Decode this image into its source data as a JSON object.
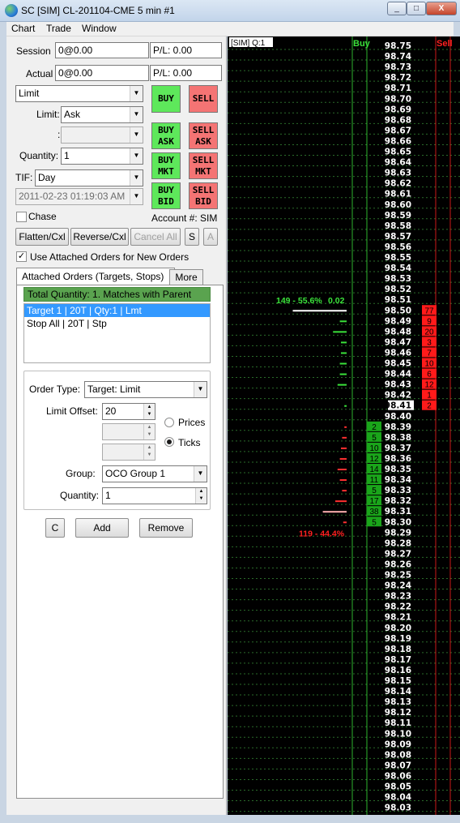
{
  "window": {
    "title": "SC [SIM] CL-201104-CME  5 min  #1",
    "minimize": "_",
    "maximize": "□",
    "close": "X"
  },
  "menu": [
    "Chart",
    "Trade",
    "Window"
  ],
  "session": {
    "label": "Session",
    "value": "0@0.00",
    "pl": "P/L: 0.00"
  },
  "actual": {
    "label": "Actual",
    "value": "0@0.00",
    "pl": "P/L: 0.00"
  },
  "order_type": "Limit",
  "limit": {
    "label": "Limit:",
    "value": "Ask"
  },
  "colon_label": ":",
  "quantity": {
    "label": "Quantity:",
    "value": "1"
  },
  "tif": {
    "label": "TIF:",
    "value": "Day"
  },
  "datetime": "2011-02-23 01:19:03 AM",
  "chase_label": "Chase",
  "account": "Account #: SIM",
  "buttons": {
    "buy": "BUY",
    "sell": "SELL",
    "buy_ask": [
      "BUY",
      "ASK"
    ],
    "sell_ask": [
      "SELL",
      "ASK"
    ],
    "buy_mkt": [
      "BUY",
      "MKT"
    ],
    "sell_mkt": [
      "SELL",
      "MKT"
    ],
    "buy_bid": [
      "BUY",
      "BID"
    ],
    "sell_bid": [
      "SELL",
      "BID"
    ],
    "flatten": "Flatten/Cxl",
    "reverse": "Reverse/Cxl",
    "cancel_all": "Cancel All",
    "s": "S",
    "a": "A",
    "c": "C",
    "add": "Add",
    "remove": "Remove"
  },
  "attached": {
    "use_label": "Use Attached Orders for New Orders",
    "tab_targets": "Attached Orders (Targets, Stops)",
    "tab_more": "More",
    "total_qty": "Total Quantity: 1. Matches with Parent",
    "list": [
      "Target 1 | 20T | Qty:1 | Lmt",
      "Stop All | 20T | Stp"
    ],
    "order_type_label": "Order Type:",
    "order_type": "Target: Limit",
    "limit_offset_label": "Limit Offset:",
    "limit_offset": "20",
    "prices_label": "Prices",
    "ticks_label": "Ticks",
    "group_label": "Group:",
    "group": "OCO Group 1",
    "quantity_label": "Quantity:",
    "quantity": "1"
  },
  "dom": {
    "header": "[SIM]  Q:1",
    "buy_label": "Buy",
    "sell_label": "Sell",
    "buy_summary": "149 - 55.6%",
    "buy_summary2": "0.02",
    "sell_summary": "119 - 44.4%",
    "prices": [
      "98.75",
      "98.74",
      "98.73",
      "98.72",
      "98.71",
      "98.70",
      "98.69",
      "98.68",
      "98.67",
      "98.66",
      "98.65",
      "98.64",
      "98.63",
      "98.62",
      "98.61",
      "98.60",
      "98.59",
      "98.58",
      "98.57",
      "98.56",
      "98.55",
      "98.54",
      "98.53",
      "98.52",
      "98.51",
      "98.50",
      "98.49",
      "98.48",
      "98.47",
      "98.46",
      "98.45",
      "98.44",
      "98.43",
      "98.42",
      "98.41",
      "98.40",
      "98.39",
      "98.38",
      "98.37",
      "98.36",
      "98.35",
      "98.34",
      "98.33",
      "98.32",
      "98.31",
      "98.30",
      "98.29",
      "98.28",
      "98.27",
      "98.26",
      "98.25",
      "98.24",
      "98.23",
      "98.22",
      "98.21",
      "98.20",
      "98.19",
      "98.18",
      "98.17",
      "98.16",
      "98.15",
      "98.14",
      "98.13",
      "98.12",
      "98.11",
      "98.10",
      "98.09",
      "98.08",
      "98.07",
      "98.06",
      "98.05",
      "98.04",
      "98.03"
    ],
    "highlight_price": "98.41",
    "asks": [
      {
        "price": "98.50",
        "size": "77"
      },
      {
        "price": "98.49",
        "size": "9"
      },
      {
        "price": "98.48",
        "size": "20"
      },
      {
        "price": "98.47",
        "size": "3"
      },
      {
        "price": "98.46",
        "size": "7"
      },
      {
        "price": "98.45",
        "size": "10"
      },
      {
        "price": "98.44",
        "size": "6"
      },
      {
        "price": "98.43",
        "size": "12"
      },
      {
        "price": "98.42",
        "size": "1"
      },
      {
        "price": "98.41",
        "size": "2"
      }
    ],
    "bids": [
      {
        "price": "98.39",
        "size": "2"
      },
      {
        "price": "98.38",
        "size": "5"
      },
      {
        "price": "98.37",
        "size": "10"
      },
      {
        "price": "98.36",
        "size": "12"
      },
      {
        "price": "98.35",
        "size": "14"
      },
      {
        "price": "98.34",
        "size": "11"
      },
      {
        "price": "98.33",
        "size": "5"
      },
      {
        "price": "98.32",
        "size": "17"
      },
      {
        "price": "98.31",
        "size": "38"
      },
      {
        "price": "98.30",
        "size": "5"
      }
    ],
    "buy_volume": [
      {
        "price": "98.50",
        "vol": 0.95
      },
      {
        "price": "98.49",
        "vol": 0.12
      },
      {
        "price": "98.48",
        "vol": 0.24
      },
      {
        "price": "98.47",
        "vol": 0.1
      },
      {
        "price": "98.46",
        "vol": 0.1
      },
      {
        "price": "98.45",
        "vol": 0.12
      },
      {
        "price": "98.44",
        "vol": 0.12
      },
      {
        "price": "98.43",
        "vol": 0.16
      },
      {
        "price": "98.41",
        "vol": 0.04
      }
    ],
    "sell_volume": [
      {
        "price": "98.39",
        "vol": 0.04
      },
      {
        "price": "98.38",
        "vol": 0.08
      },
      {
        "price": "98.37",
        "vol": 0.1
      },
      {
        "price": "98.36",
        "vol": 0.12
      },
      {
        "price": "98.35",
        "vol": 0.16
      },
      {
        "price": "98.34",
        "vol": 0.12
      },
      {
        "price": "98.33",
        "vol": 0.08
      },
      {
        "price": "98.32",
        "vol": 0.2
      },
      {
        "price": "98.31",
        "vol": 0.42
      },
      {
        "price": "98.30",
        "vol": 0.06
      }
    ],
    "colors": {
      "ask_bg": "#ff1a1a",
      "bid_bg": "#1aa51a",
      "buy_col": "#3ae23a",
      "sell_col": "#ff2020",
      "price": "#ffffff",
      "grid": "#2a6b2a"
    }
  }
}
